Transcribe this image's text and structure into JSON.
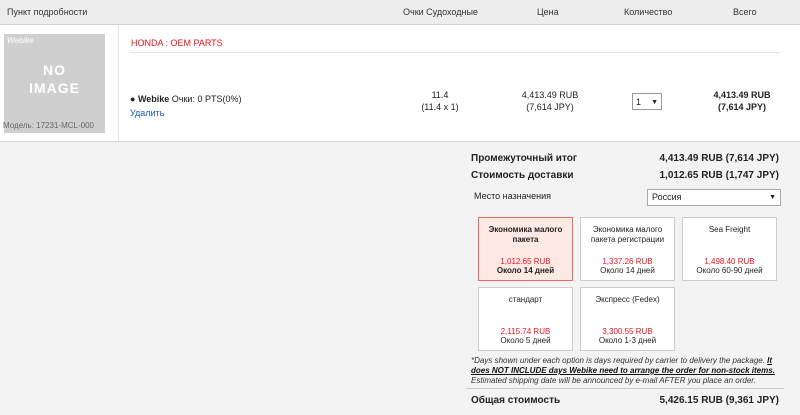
{
  "headers": {
    "item": "Пункт подробности",
    "points": "Очки Судоходные",
    "price": "Цена",
    "qty": "Количество",
    "total": "Всего"
  },
  "item": {
    "image_brand": "Webike",
    "no_line": "NO",
    "image_line": "IMAGE",
    "model": "Модель: 17231-MCL-000",
    "brand": "HONDA : OEM PARTS",
    "points_prefix": "● ",
    "points_label": "Webike",
    "points_text": " Очки: 0 PTS(0%)",
    "delete": "Удалить",
    "points_val": "11.4",
    "points_calc": "(11.4 x 1)",
    "price": "4,413.49 RUB",
    "price_jpy": "(7,614 JPY)",
    "qty": "1",
    "qty_arrow": "▼",
    "total": "4,413.49 RUB",
    "total_jpy": "(7,614 JPY)"
  },
  "summary": {
    "subtotal_label": "Промежуточный итог",
    "subtotal_value": "4,413.49 RUB (7,614 JPY)",
    "shipping_label": "Стоимость доставки",
    "shipping_value": "1,012.65 RUB (1,747 JPY)",
    "dest_label": "Место назначения",
    "dest_value": "Россия",
    "dest_arrow": "▼",
    "options": [
      {
        "name": "Экономика малого пакета",
        "price": "1,012.65 RUB",
        "days": "Около 14  дней"
      },
      {
        "name": "Экономика малого пакета регистрации",
        "price": "1,337.26 RUB",
        "days": "Около 14  дней"
      },
      {
        "name": "Sea Freight",
        "price": "1,498.40 RUB",
        "days": "Около 60-90  дней"
      },
      {
        "name": "стандарт",
        "price": "2,115.74 RUB",
        "days": "Около 5  дней"
      },
      {
        "name": "Экспресс (Fedex)",
        "price": "3,300.55 RUB",
        "days": "Около 1-3  дней"
      }
    ],
    "note_pre": "*Days shown under each option is days required by carrier to delivery the package. ",
    "note_bold": "It does NOT INCLUDE days Webike need to arrange the order for non-stock items.",
    "note_post": " Estimated shipping date will be announced by e-mail AFTER you place an order.",
    "grand_label": "Общая стоимость",
    "grand_value": "5,426.15 RUB (9,361 JPY)"
  }
}
